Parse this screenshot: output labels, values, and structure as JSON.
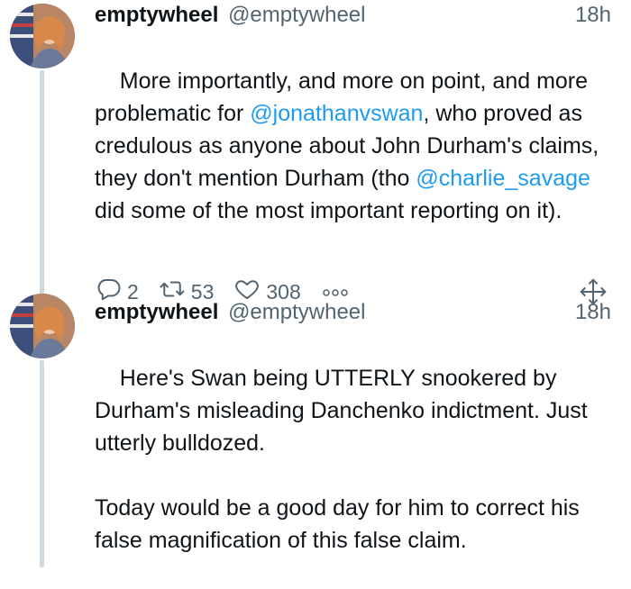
{
  "tweets": [
    {
      "display_name": "emptywheel",
      "handle": "@emptywheel",
      "time": "18h",
      "text": [
        {
          "t": "More importantly, and more on point, and more problematic for "
        },
        {
          "t": "@jonathanvswan",
          "mention": true
        },
        {
          "t": ", who proved as credulous as anyone about John Durham's claims, they don't mention Durham (tho "
        },
        {
          "t": "@charlie_savage",
          "mention": true
        },
        {
          "t": " did some of the most important reporting on it)."
        }
      ],
      "replies": "2",
      "retweets": "53",
      "likes": "308",
      "icons": {
        "reply": "reply-icon",
        "retweet": "retweet-icon",
        "like": "heart-icon",
        "more": "more-icon",
        "share": "share-icon"
      }
    },
    {
      "display_name": "emptywheel",
      "handle": "@emptywheel",
      "time": "18h",
      "text": [
        {
          "t": "Here's Swan being UTTERLY snookered by Durham's misleading Danchenko indictment. Just utterly bulldozed.\n\nToday would be a good day for him to correct his false magnification of this false claim."
        }
      ]
    }
  ],
  "colors": {
    "text": "#0f1419",
    "secondary": "#536471",
    "link": "#1d9bf0",
    "thread_line": "#cfd9de"
  }
}
